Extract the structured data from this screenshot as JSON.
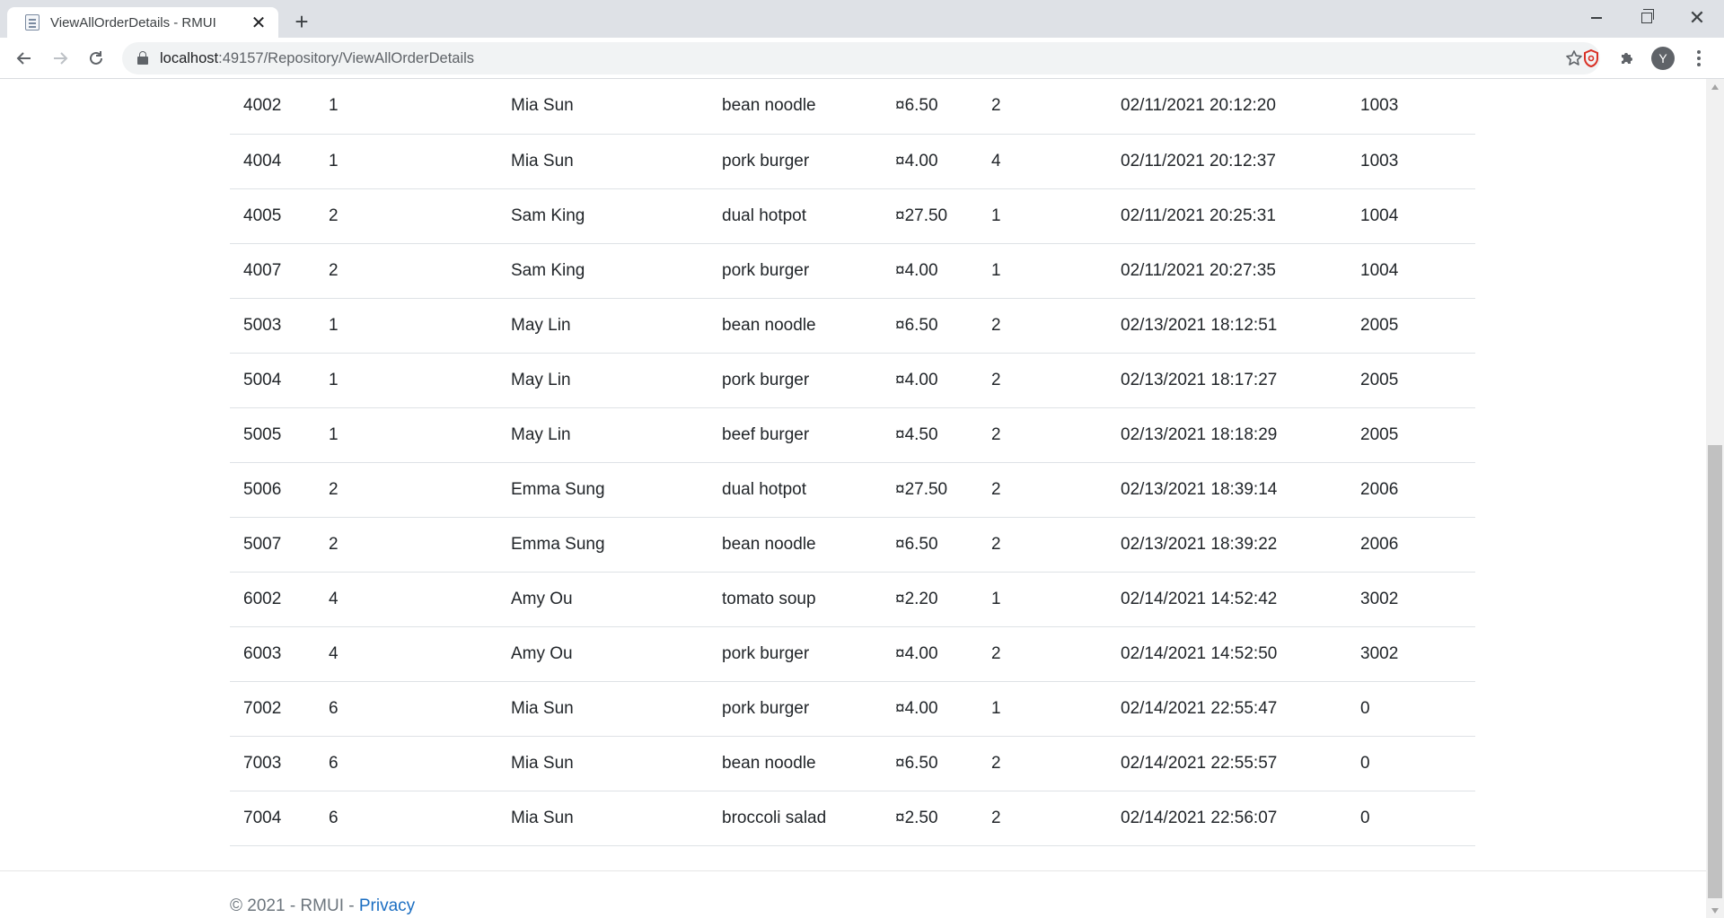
{
  "browser": {
    "tab_title": "ViewAllOrderDetails - RMUI",
    "url_host": "localhost",
    "url_path": ":49157/Repository/ViewAllOrderDetails",
    "profile_initial": "Y"
  },
  "orders": {
    "rows": [
      [
        "4002",
        "1",
        "Mia Sun",
        "bean noodle",
        "¤6.50",
        "2",
        "02/11/2021 20:12:20",
        "1003"
      ],
      [
        "4004",
        "1",
        "Mia Sun",
        "pork burger",
        "¤4.00",
        "4",
        "02/11/2021 20:12:37",
        "1003"
      ],
      [
        "4005",
        "2",
        "Sam King",
        "dual hotpot",
        "¤27.50",
        "1",
        "02/11/2021 20:25:31",
        "1004"
      ],
      [
        "4007",
        "2",
        "Sam King",
        "pork burger",
        "¤4.00",
        "1",
        "02/11/2021 20:27:35",
        "1004"
      ],
      [
        "5003",
        "1",
        "May Lin",
        "bean noodle",
        "¤6.50",
        "2",
        "02/13/2021 18:12:51",
        "2005"
      ],
      [
        "5004",
        "1",
        "May Lin",
        "pork burger",
        "¤4.00",
        "2",
        "02/13/2021 18:17:27",
        "2005"
      ],
      [
        "5005",
        "1",
        "May Lin",
        "beef burger",
        "¤4.50",
        "2",
        "02/13/2021 18:18:29",
        "2005"
      ],
      [
        "5006",
        "2",
        "Emma Sung",
        "dual hotpot",
        "¤27.50",
        "2",
        "02/13/2021 18:39:14",
        "2006"
      ],
      [
        "5007",
        "2",
        "Emma Sung",
        "bean noodle",
        "¤6.50",
        "2",
        "02/13/2021 18:39:22",
        "2006"
      ],
      [
        "6002",
        "4",
        "Amy Ou",
        "tomato soup",
        "¤2.20",
        "1",
        "02/14/2021 14:52:42",
        "3002"
      ],
      [
        "6003",
        "4",
        "Amy Ou",
        "pork burger",
        "¤4.00",
        "2",
        "02/14/2021 14:52:50",
        "3002"
      ],
      [
        "7002",
        "6",
        "Mia Sun",
        "pork burger",
        "¤4.00",
        "1",
        "02/14/2021 22:55:47",
        "0"
      ],
      [
        "7003",
        "6",
        "Mia Sun",
        "bean noodle",
        "¤6.50",
        "2",
        "02/14/2021 22:55:57",
        "0"
      ],
      [
        "7004",
        "6",
        "Mia Sun",
        "broccoli salad",
        "¤2.50",
        "2",
        "02/14/2021 22:56:07",
        "0"
      ]
    ]
  },
  "footer": {
    "copyright": "© 2021 - RMUI - ",
    "privacy_link": "Privacy"
  },
  "colors": {
    "link": "#1b6ec2",
    "row_border": "#dee2e6",
    "text": "#212529"
  }
}
